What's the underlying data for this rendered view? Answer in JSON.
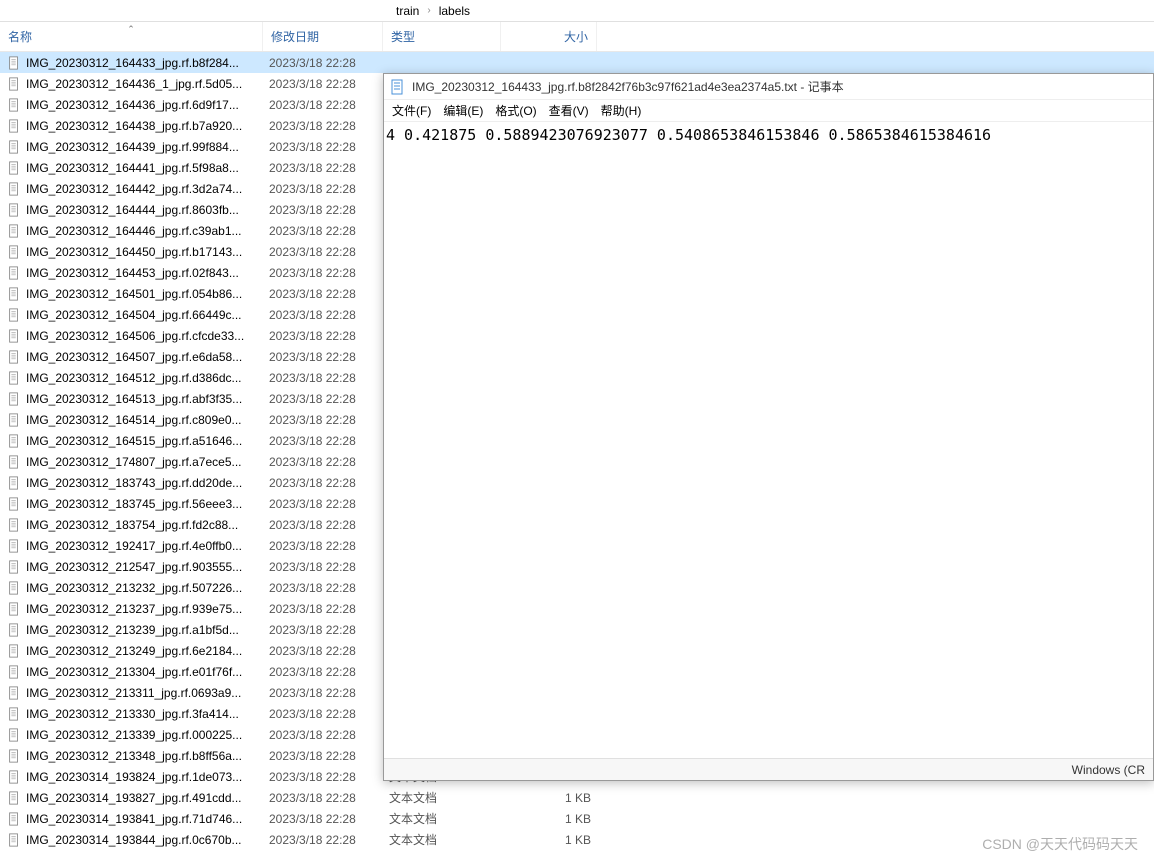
{
  "breadcrumb": {
    "crumb1": "train",
    "crumb2": "labels"
  },
  "columns": {
    "name": "名称",
    "date": "修改日期",
    "type": "类型",
    "size": "大小"
  },
  "default_date": "2023/3/18 22:28",
  "default_type": "文本文档",
  "default_size": "1 KB",
  "files": [
    {
      "name": "IMG_20230312_164433_jpg.rf.b8f284...",
      "selected": true
    },
    {
      "name": "IMG_20230312_164436_1_jpg.rf.5d05..."
    },
    {
      "name": "IMG_20230312_164436_jpg.rf.6d9f17..."
    },
    {
      "name": "IMG_20230312_164438_jpg.rf.b7a920..."
    },
    {
      "name": "IMG_20230312_164439_jpg.rf.99f884..."
    },
    {
      "name": "IMG_20230312_164441_jpg.rf.5f98a8..."
    },
    {
      "name": "IMG_20230312_164442_jpg.rf.3d2a74..."
    },
    {
      "name": "IMG_20230312_164444_jpg.rf.8603fb..."
    },
    {
      "name": "IMG_20230312_164446_jpg.rf.c39ab1..."
    },
    {
      "name": "IMG_20230312_164450_jpg.rf.b17143..."
    },
    {
      "name": "IMG_20230312_164453_jpg.rf.02f843..."
    },
    {
      "name": "IMG_20230312_164501_jpg.rf.054b86..."
    },
    {
      "name": "IMG_20230312_164504_jpg.rf.66449c..."
    },
    {
      "name": "IMG_20230312_164506_jpg.rf.cfcde33..."
    },
    {
      "name": "IMG_20230312_164507_jpg.rf.e6da58..."
    },
    {
      "name": "IMG_20230312_164512_jpg.rf.d386dc..."
    },
    {
      "name": "IMG_20230312_164513_jpg.rf.abf3f35..."
    },
    {
      "name": "IMG_20230312_164514_jpg.rf.c809e0..."
    },
    {
      "name": "IMG_20230312_164515_jpg.rf.a51646..."
    },
    {
      "name": "IMG_20230312_174807_jpg.rf.a7ece5..."
    },
    {
      "name": "IMG_20230312_183743_jpg.rf.dd20de..."
    },
    {
      "name": "IMG_20230312_183745_jpg.rf.56eee3..."
    },
    {
      "name": "IMG_20230312_183754_jpg.rf.fd2c88..."
    },
    {
      "name": "IMG_20230312_192417_jpg.rf.4e0ffb0..."
    },
    {
      "name": "IMG_20230312_212547_jpg.rf.903555..."
    },
    {
      "name": "IMG_20230312_213232_jpg.rf.507226..."
    },
    {
      "name": "IMG_20230312_213237_jpg.rf.939e75..."
    },
    {
      "name": "IMG_20230312_213239_jpg.rf.a1bf5d..."
    },
    {
      "name": "IMG_20230312_213249_jpg.rf.6e2184..."
    },
    {
      "name": "IMG_20230312_213304_jpg.rf.e01f76f..."
    },
    {
      "name": "IMG_20230312_213311_jpg.rf.0693a9..."
    },
    {
      "name": "IMG_20230312_213330_jpg.rf.3fa414..."
    },
    {
      "name": "IMG_20230312_213339_jpg.rf.000225..."
    },
    {
      "name": "IMG_20230312_213348_jpg.rf.b8ff56a..."
    },
    {
      "name": "IMG_20230314_193824_jpg.rf.1de073...",
      "type_visible": true
    },
    {
      "name": "IMG_20230314_193827_jpg.rf.491cdd...",
      "type_visible": true
    },
    {
      "name": "IMG_20230314_193841_jpg.rf.71d746...",
      "type_visible": true
    },
    {
      "name": "IMG_20230314_193844_jpg.rf.0c670b...",
      "type_visible": true
    }
  ],
  "notepad": {
    "title": "IMG_20230312_164433_jpg.rf.b8f2842f76b3c97f621ad4e3ea2374a5.txt - 记事本",
    "menu": {
      "file": "文件(F)",
      "edit": "编辑(E)",
      "format": "格式(O)",
      "view": "查看(V)",
      "help": "帮助(H)"
    },
    "content": "4 0.421875 0.5889423076923077 0.5408653846153846 0.5865384615384616",
    "status": "Windows (CR"
  },
  "watermark": "CSDN @天天代码码天天"
}
